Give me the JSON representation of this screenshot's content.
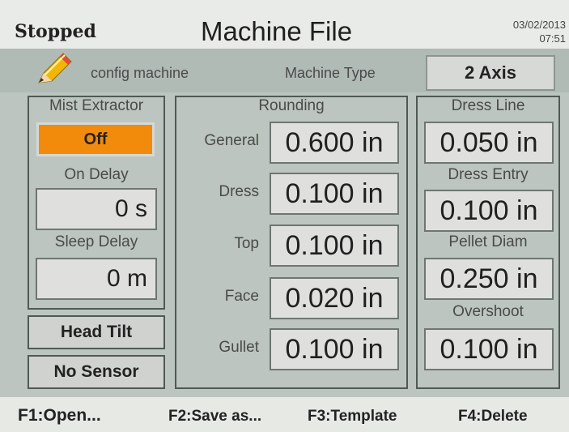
{
  "header": {
    "status": "Stopped",
    "title": "Machine File",
    "date": "03/02/2013",
    "time": "07:51"
  },
  "config": {
    "icon": "pencil-icon",
    "label": "config machine",
    "machine_type_label": "Machine Type",
    "machine_type_value": "2 Axis"
  },
  "mist_extractor": {
    "title": "Mist Extractor",
    "state": "Off",
    "on_delay_label": "On Delay",
    "on_delay_value": "0 s",
    "sleep_delay_label": "Sleep Delay",
    "sleep_delay_value": "0 m"
  },
  "buttons": {
    "head_tilt": "Head Tilt",
    "no_sensor": "No Sensor"
  },
  "rounding": {
    "title": "Rounding",
    "rows": [
      {
        "label": "General",
        "value": "0.600 in"
      },
      {
        "label": "Dress",
        "value": "0.100 in"
      },
      {
        "label": "Top",
        "value": "0.100 in"
      },
      {
        "label": "Face",
        "value": "0.020 in"
      },
      {
        "label": "Gullet",
        "value": "0.100 in"
      }
    ]
  },
  "dress_line": {
    "title": "Dress Line",
    "value": "0.050 in",
    "dress_entry_label": "Dress Entry",
    "dress_entry_value": "0.100 in",
    "pellet_diam_label": "Pellet Diam",
    "pellet_diam_value": "0.250 in",
    "overshoot_label": "Overshoot",
    "overshoot_value": "0.100 in"
  },
  "function_keys": [
    "F1:Open...",
    "F2:Save as...",
    "F3:Template",
    "F4:Delete"
  ],
  "colors": {
    "accent_orange": "#f28a0b",
    "panel_bg": "#bcc5bf"
  }
}
